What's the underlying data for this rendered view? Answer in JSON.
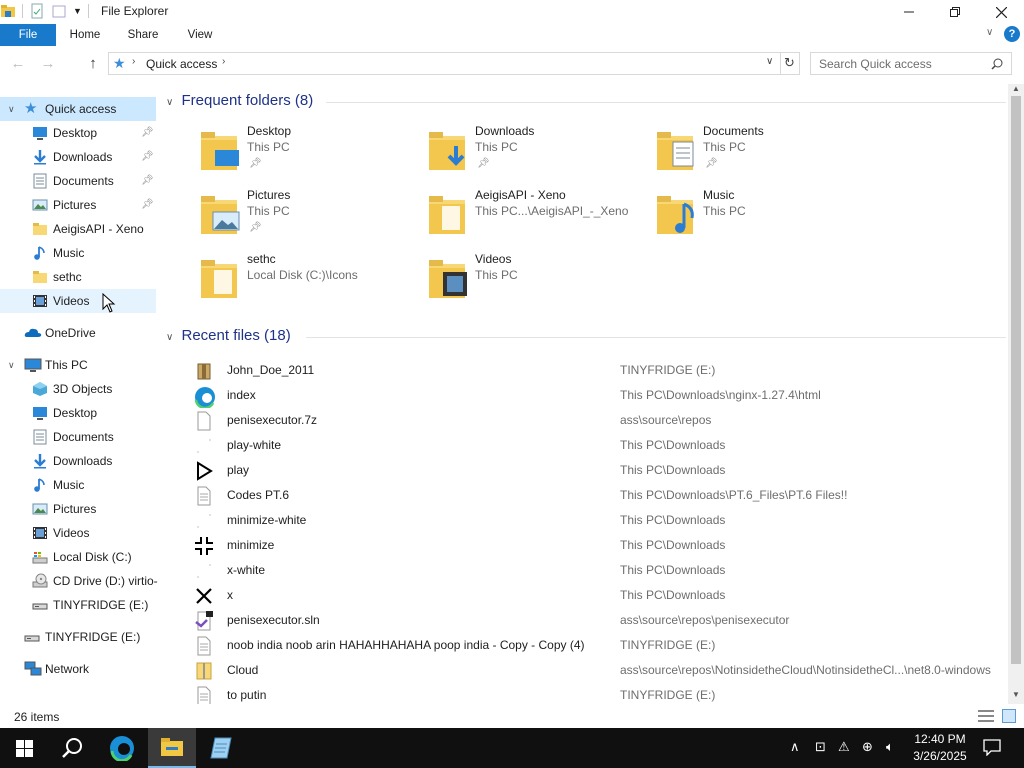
{
  "window": {
    "title": "File Explorer"
  },
  "ribbon": {
    "tabs": [
      "File",
      "Home",
      "Share",
      "View"
    ]
  },
  "address": {
    "location": "Quick access"
  },
  "search": {
    "placeholder": "Search Quick access"
  },
  "nav": {
    "quick_access": "Quick access",
    "quick_items": [
      {
        "label": "Desktop",
        "icon": "desktop-icon",
        "pinned": true
      },
      {
        "label": "Downloads",
        "icon": "downloads-icon",
        "pinned": true
      },
      {
        "label": "Documents",
        "icon": "documents-icon",
        "pinned": true
      },
      {
        "label": "Pictures",
        "icon": "pictures-icon",
        "pinned": true
      },
      {
        "label": "AeigisAPI - Xeno",
        "icon": "folder-icon",
        "pinned": false
      },
      {
        "label": "Music",
        "icon": "music-icon",
        "pinned": false
      },
      {
        "label": "sethc",
        "icon": "folder-icon",
        "pinned": false
      },
      {
        "label": "Videos",
        "icon": "videos-icon",
        "pinned": false
      }
    ],
    "onedrive": "OneDrive",
    "this_pc": "This PC",
    "pc_items": [
      {
        "label": "3D Objects",
        "icon": "3d-objects-icon"
      },
      {
        "label": "Desktop",
        "icon": "desktop-icon"
      },
      {
        "label": "Documents",
        "icon": "documents-icon"
      },
      {
        "label": "Downloads",
        "icon": "downloads-icon"
      },
      {
        "label": "Music",
        "icon": "music-icon"
      },
      {
        "label": "Pictures",
        "icon": "pictures-icon"
      },
      {
        "label": "Videos",
        "icon": "videos-icon"
      },
      {
        "label": "Local Disk (C:)",
        "icon": "local-disk-icon"
      },
      {
        "label": "CD Drive (D:) virtio-",
        "icon": "cd-drive-icon"
      },
      {
        "label": "TINYFRIDGE (E:)",
        "icon": "usb-drive-icon"
      }
    ],
    "tinyfridge": "TINYFRIDGE (E:)",
    "network": "Network"
  },
  "frequent": {
    "heading": "Frequent folders (8)",
    "folders": [
      {
        "name": "Desktop",
        "location": "This PC",
        "pinned": true,
        "overlay": "desktop"
      },
      {
        "name": "Downloads",
        "location": "This PC",
        "pinned": true,
        "overlay": "download"
      },
      {
        "name": "Documents",
        "location": "This PC",
        "pinned": true,
        "overlay": "document"
      },
      {
        "name": "Pictures",
        "location": "This PC",
        "pinned": true,
        "overlay": "picture"
      },
      {
        "name": "AeigisAPI - Xeno",
        "location": "This PC...\\AeigisAPI_-_Xeno",
        "pinned": false,
        "overlay": "plain"
      },
      {
        "name": "Music",
        "location": "This PC",
        "pinned": false,
        "overlay": "music"
      },
      {
        "name": "sethc",
        "location": "Local Disk (C:)\\Icons",
        "pinned": false,
        "overlay": "plain"
      },
      {
        "name": "Videos",
        "location": "This PC",
        "pinned": false,
        "overlay": "video"
      }
    ]
  },
  "recent": {
    "heading": "Recent files (18)",
    "files": [
      {
        "name": "John_Doe_2011",
        "location": "TINYFRIDGE (E:)",
        "icon": "archive-icon"
      },
      {
        "name": "index",
        "location": "This PC\\Downloads\\nginx-1.27.4\\html",
        "icon": "edge-icon"
      },
      {
        "name": "penisexecutor.7z",
        "location": "ass\\source\\repos",
        "icon": "blank-file-icon"
      },
      {
        "name": "play-white",
        "location": "This PC\\Downloads",
        "icon": "white-image-icon"
      },
      {
        "name": "play",
        "location": "This PC\\Downloads",
        "icon": "play-icon"
      },
      {
        "name": "Codes PT.6",
        "location": "This PC\\Downloads\\PT.6_Files\\PT.6 Files!!",
        "icon": "text-file-icon"
      },
      {
        "name": "minimize-white",
        "location": "This PC\\Downloads",
        "icon": "white-image-icon"
      },
      {
        "name": "minimize",
        "location": "This PC\\Downloads",
        "icon": "minimize-icon"
      },
      {
        "name": "x-white",
        "location": "This PC\\Downloads",
        "icon": "white-image-icon"
      },
      {
        "name": "x",
        "location": "This PC\\Downloads",
        "icon": "x-icon"
      },
      {
        "name": "penisexecutor.sln",
        "location": "ass\\source\\repos\\penisexecutor",
        "icon": "visual-studio-icon"
      },
      {
        "name": "noob india noob arin HAHAHHAHAHA poop india - Copy - Copy (4)",
        "location": "TINYFRIDGE (E:)",
        "icon": "text-file-icon"
      },
      {
        "name": "Cloud",
        "location": "ass\\source\\repos\\NotinsidetheCloud\\NotinsidetheCl...\\net8.0-windows",
        "icon": "zip-icon"
      },
      {
        "name": "to putin",
        "location": "TINYFRIDGE (E:)",
        "icon": "text-file-icon"
      }
    ]
  },
  "status": {
    "count": "26 items"
  },
  "taskbar": {
    "time": "12:40 PM",
    "date": "3/26/2025"
  },
  "colors": {
    "accent": "#1979ca",
    "heading": "#1e3287",
    "selection": "#cce8ff",
    "taskbar": "#101010"
  }
}
